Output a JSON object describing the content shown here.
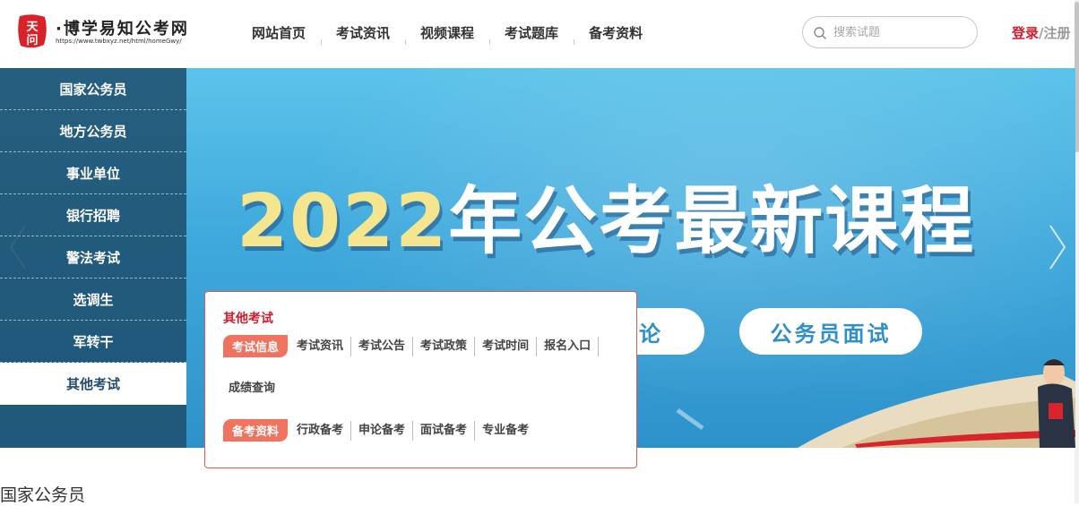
{
  "header": {
    "logo_seal": "天问",
    "logo_name": "·博学易知公考网",
    "logo_url": "https://www.twbxyz.net/html/homeGwy/",
    "nav": [
      "网站首页",
      "考试资讯",
      "视频课程",
      "考试题库",
      "备考资料"
    ],
    "search_placeholder": "搜索试题",
    "login_label": "登录",
    "separator": "/",
    "register_label": "注册"
  },
  "banner": {
    "year": "2022",
    "title_rest": "年公考最新课程",
    "pill_1": "申论",
    "pill_2": "公务员面试"
  },
  "sidebar": {
    "items": [
      "国家公务员",
      "地方公务员",
      "事业单位",
      "银行招聘",
      "警法考试",
      "选调生",
      "军转干",
      "其他考试"
    ],
    "active_index": 7
  },
  "popup": {
    "title": "其他考试",
    "group_1": {
      "tag": "考试信息",
      "links": [
        "考试资讯",
        "考试公告",
        "考试政策",
        "考试时间",
        "报名入口",
        "成绩查询"
      ]
    },
    "group_2": {
      "tag": "备考资料",
      "links": [
        "行政备考",
        "申论备考",
        "面试备考",
        "专业备考"
      ]
    }
  },
  "section": {
    "title": "国家公务员"
  },
  "colors": {
    "brand_red": "#d61c2c",
    "tag_orange": "#f0735f",
    "sidebar_bg": "#1e506e",
    "banner_blue": "#3fa9dc"
  },
  "icons": [
    "search-icon",
    "chevron-left-icon",
    "chevron-right-icon",
    "logo-seal-icon"
  ]
}
